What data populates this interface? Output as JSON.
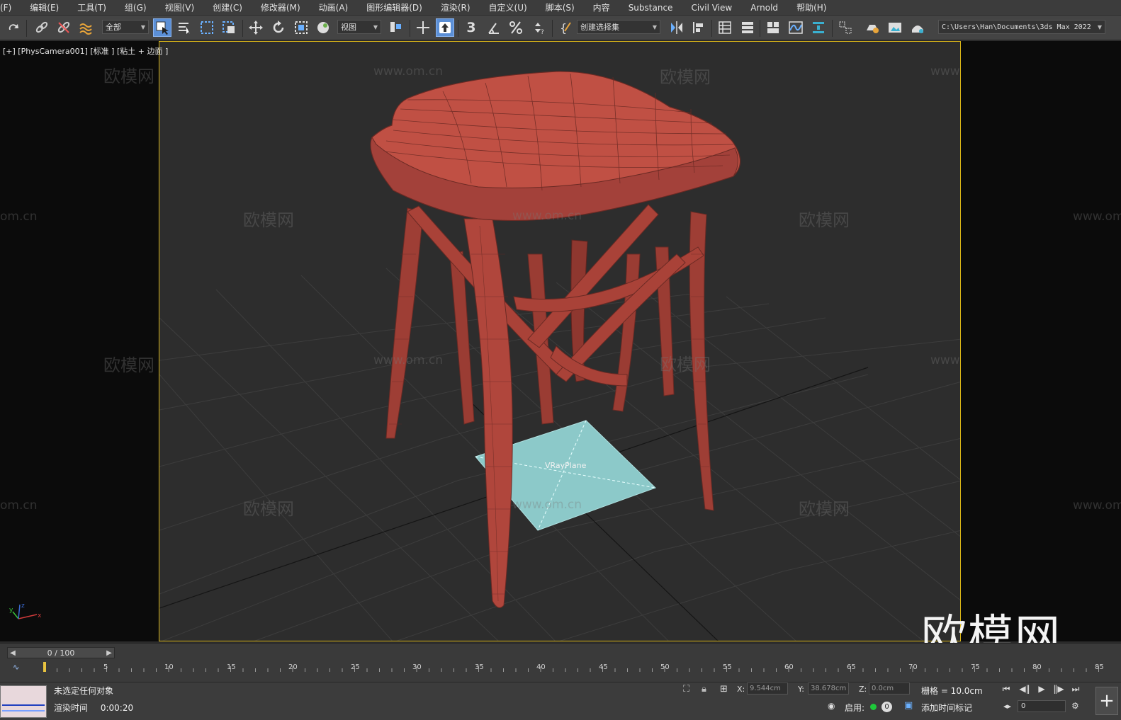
{
  "menu": [
    "(F)",
    "编辑(E)",
    "工具(T)",
    "组(G)",
    "视图(V)",
    "创建(C)",
    "修改器(M)",
    "动画(A)",
    "图形编辑器(D)",
    "渲染(R)",
    "自定义(U)",
    "脚本(S)",
    "内容",
    "Substance",
    "Civil View",
    "Arnold",
    "帮助(H)"
  ],
  "toolbar": {
    "selection_filter": "全部",
    "ref_coord": "视图",
    "named_selection": "创建选择集",
    "project_path": "C:\\Users\\Han\\Documents\\3ds Max 2022",
    "snap_number": "3"
  },
  "viewport": {
    "label": "[+] [PhysCamera001] [标准 ] [粘土 + 边面 ]",
    "object_label": "VRayPlane",
    "watermark_text": "欧模网",
    "watermark_url": "www.om.cn",
    "watermark_url_partial": "om.cn",
    "axis_x": "x",
    "axis_y": "y",
    "axis_z": "z",
    "brand_logo": "欧模网",
    "model_color": "#b0463c",
    "plane_color": "#8cc9c9",
    "border_color": "#d8b417"
  },
  "timeline": {
    "position": "0 / 100",
    "ticks": [
      "5",
      "10",
      "15",
      "20",
      "25",
      "30",
      "35",
      "40",
      "45",
      "50",
      "55",
      "60",
      "65",
      "70",
      "75",
      "80",
      "85"
    ]
  },
  "status": {
    "message": "未选定任何对象",
    "render_time_label": "渲染时间",
    "render_time_value": "0:00:20",
    "x_label": "X:",
    "x_value": "9.544cm",
    "y_label": "Y:",
    "y_value": "38.678cm",
    "z_label": "Z:",
    "z_value": "0.0cm",
    "grid": "栅格 = 10.0cm",
    "enable_label": "启用:",
    "enable_count": "0",
    "add_time_tag": "添加时间标记",
    "frame_value": "0"
  }
}
